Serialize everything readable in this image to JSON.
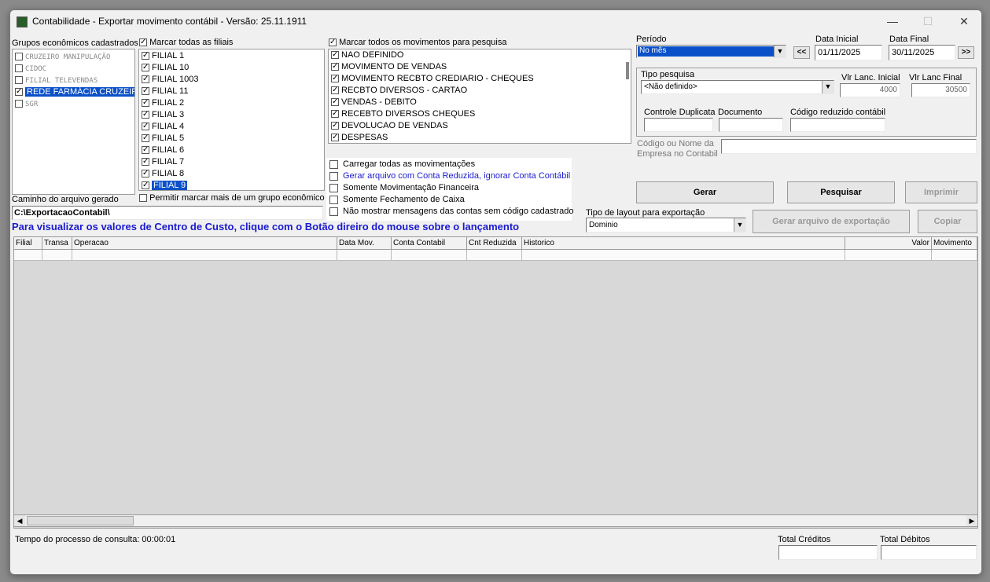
{
  "window": {
    "title": "Contabilidade - Exportar movimento contábil - Versão: 25.11.1911",
    "minimize": "—",
    "maximize": "☐",
    "close": "✕"
  },
  "grupos": {
    "label": "Grupos econômicos cadastrados",
    "items": [
      {
        "label": "CRUZEIRO MANIPULAÇÃO",
        "checked": false
      },
      {
        "label": "CIDOC",
        "checked": false
      },
      {
        "label": "FILIAL TELEVENDAS",
        "checked": false
      },
      {
        "label": "REDE FARMÁCIA CRUZEIRO",
        "checked": true,
        "selected": true
      },
      {
        "label": "SGR",
        "checked": false
      }
    ]
  },
  "filiais": {
    "label": "Marcar todas as filiais",
    "items": [
      "FILIAL 1",
      "FILIAL 10",
      "FILIAL 1003",
      "FILIAL 11",
      "FILIAL 2",
      "FILIAL 3",
      "FILIAL 4",
      "FILIAL 5",
      "FILIAL 6",
      "FILIAL 7",
      "FILIAL 8",
      "FILIAL 9"
    ],
    "multi_group_label": "Permitir marcar mais de um grupo econômico"
  },
  "movimentos": {
    "label": "Marcar todos os movimentos para pesquisa",
    "items": [
      "NAO DEFINIDO",
      "MOVIMENTO DE VENDAS",
      "MOVIMENTO RECBTO CREDIARIO - CHEQUES",
      "RECBTO DIVERSOS - CARTAO",
      "VENDAS - DEBITO",
      "RECEBTO DIVERSOS CHEQUES",
      "DEVOLUCAO DE VENDAS",
      "DESPESAS"
    ]
  },
  "options": [
    {
      "label": "Carregar todas as movimentações",
      "blue": false
    },
    {
      "label": "Gerar arquivo com Conta Reduzida, ignorar Conta Contábil",
      "blue": true
    },
    {
      "label": "Somente Movimentação Financeira",
      "blue": false
    },
    {
      "label": "Somente Fechamento de Caixa",
      "blue": false
    },
    {
      "label": "Não mostrar mensagens das contas sem código cadastrado",
      "blue": false
    }
  ],
  "caminho": {
    "label": "Caminho do arquivo gerado",
    "value": "C:\\ExportacaoContabil\\"
  },
  "info_message": "Para visualizar os valores de Centro de Custo, clique com o Botão direiro do mouse sobre o lançamento",
  "periodo": {
    "label": "Período",
    "value": "No mês",
    "prev": "<<",
    "next": ">>"
  },
  "data_inicial": {
    "label": "Data Inicial",
    "value": "01/11/2025"
  },
  "data_final": {
    "label": "Data Final",
    "value": "30/11/2025"
  },
  "tipo_pesquisa": {
    "label": "Tipo pesquisa",
    "value": "<Não definido>"
  },
  "vlr_inicial": {
    "label": "Vlr Lanc. Inicial",
    "value": "4000"
  },
  "vlr_final": {
    "label": "Vlr Lanc Final",
    "value": "30500"
  },
  "controle_duplicata": {
    "label": "Controle Duplicata",
    "value": ""
  },
  "documento": {
    "label": "Documento",
    "value": ""
  },
  "codigo_reduzido": {
    "label": "Código reduzido contábil",
    "value": ""
  },
  "empresa": {
    "label_line1": "Código ou Nome da",
    "label_line2": "Empresa no Contabil",
    "value": ""
  },
  "buttons": {
    "gerar": "Gerar",
    "pesquisar": "Pesquisar",
    "imprimir": "Imprimir",
    "gerar_arquivo": "Gerar arquivo de exportação",
    "copiar": "Copiar"
  },
  "layout": {
    "label": "Tipo de layout para exportação",
    "value": "Dominio"
  },
  "grid": {
    "columns": [
      "Filial",
      "Transa",
      "Operacao",
      "Data Mov.",
      "Conta Contabil",
      "Cnt Reduzida",
      "Historico",
      "Valor",
      "Movimento"
    ]
  },
  "status": {
    "tempo": "Tempo do processo de consulta: 00:00:01"
  },
  "totais": {
    "creditos_label": "Total Créditos",
    "debitos_label": "Total Débitos",
    "creditos": "",
    "debitos": ""
  },
  "colors": {
    "selection": "#0a50c8",
    "info_blue": "#1a1ad0"
  }
}
